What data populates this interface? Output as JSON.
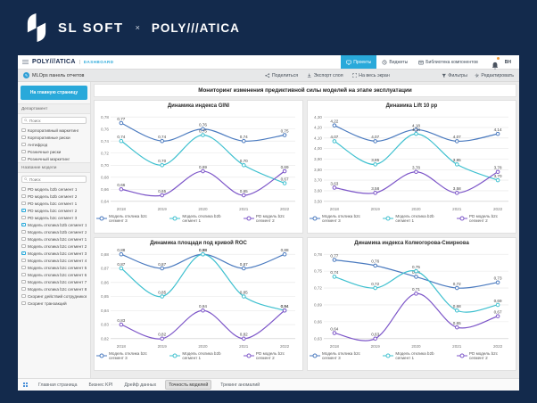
{
  "banner": {
    "brand_left": "SL SOFT",
    "separator": "×",
    "brand_right": "POLY///ATICA"
  },
  "app_header": {
    "logo": "POLY///ATICA",
    "badge": "DASHBOARD",
    "tabs": [
      {
        "label": "Проекты",
        "icon": "monitor-icon",
        "active": true
      },
      {
        "label": "Виджеты",
        "icon": "widgets-icon",
        "active": false
      },
      {
        "label": "Библиотека компонентов",
        "icon": "components-icon",
        "active": false
      }
    ],
    "user_initials": "ВН"
  },
  "toolbar": {
    "report_title": "MLOps панель отчетов",
    "actions": [
      {
        "label": "Поделиться",
        "icon": "share-icon"
      },
      {
        "label": "Экспорт слоя",
        "icon": "export-icon"
      },
      {
        "label": "На весь экран",
        "icon": "fullscreen-icon"
      }
    ],
    "right_actions": [
      {
        "label": "Фильтры",
        "icon": "filter-icon"
      },
      {
        "label": "Редактировать",
        "icon": "gear-icon"
      }
    ]
  },
  "sidebar": {
    "home_button": "На главную страницу",
    "sections": [
      {
        "title": "Департамент",
        "search_placeholder": "Поиск",
        "items": [
          {
            "label": "Корпоративный маркетинг",
            "checked": false
          },
          {
            "label": "Корпоративные риски",
            "checked": false
          },
          {
            "label": "Антифрод",
            "checked": false
          },
          {
            "label": "Розничные риски",
            "checked": false
          },
          {
            "label": "Розничный маркетинг",
            "checked": false
          }
        ]
      },
      {
        "title": "Название модели",
        "search_placeholder": "Поиск",
        "items": [
          {
            "label": "PD модель b2b сегмент 1",
            "checked": false
          },
          {
            "label": "PD модель b2b сегмент 2",
            "checked": false
          },
          {
            "label": "PD модель b2c сегмент 1",
            "checked": false
          },
          {
            "label": "PD модель b2c сегмент 2",
            "checked": true
          },
          {
            "label": "PD модель b2c сегмент 3",
            "checked": false
          },
          {
            "label": "Модель отклика b2b сегмент 1",
            "checked": true
          },
          {
            "label": "Модель отклика b2b сегмент 2",
            "checked": false
          },
          {
            "label": "Модель отклика b2c сегмент 1",
            "checked": false
          },
          {
            "label": "Модель отклика b2c сегмент 2",
            "checked": false
          },
          {
            "label": "Модель отклика b2c сегмент 3",
            "checked": true
          },
          {
            "label": "Модель отклика b2c сегмент 4",
            "checked": false
          },
          {
            "label": "Модель отклика b2c сегмент 5",
            "checked": false
          },
          {
            "label": "Модель отклика b2c сегмент 6",
            "checked": false
          },
          {
            "label": "Модель отклика b2c сегмент 7",
            "checked": false
          },
          {
            "label": "Модель отклика b2c сегмент 8",
            "checked": false
          },
          {
            "label": "Скоринг действий сотрудников",
            "checked": false
          },
          {
            "label": "Скоринг транзакций",
            "checked": false
          }
        ]
      }
    ]
  },
  "main": {
    "title": "Мониторинг изменения предиктивной силы моделей на этапе эксплуатации"
  },
  "chart_data": [
    {
      "type": "line",
      "title": "Динамика индекса GINI",
      "x": [
        "2018",
        "2019",
        "2020",
        "2021",
        "2022"
      ],
      "ylim": [
        0.64,
        0.78
      ],
      "ystep": 0.02,
      "decimals": 2,
      "grid": true,
      "legend_position": "bottom",
      "series": [
        {
          "name": "Модель отклика b2c сегмент 3",
          "color": "#4a7abf",
          "values": [
            0.77,
            0.74,
            0.76,
            0.74,
            0.75
          ]
        },
        {
          "name": "Модель отклика b2b сегмент 1",
          "color": "#3ec0cf",
          "values": [
            0.74,
            0.7,
            0.75,
            0.7,
            0.67
          ]
        },
        {
          "name": "PD модель b2c сегмент 2",
          "color": "#7c55c8",
          "values": [
            0.66,
            0.65,
            0.69,
            0.65,
            0.69
          ]
        }
      ]
    },
    {
      "type": "line",
      "title": "Динамика Lift 10 pp",
      "x": [
        "2018",
        "2019",
        "2020",
        "2021",
        "2022"
      ],
      "ylim": [
        3.5,
        4.3
      ],
      "ystep": 0.1,
      "decimals": 2,
      "grid": true,
      "legend_position": "bottom",
      "series": [
        {
          "name": "Модель отклика b2c сегмент 3",
          "color": "#4a7abf",
          "values": [
            4.22,
            4.07,
            4.18,
            4.07,
            4.14
          ]
        },
        {
          "name": "Модель отклика b2b сегмент 1",
          "color": "#3ec0cf",
          "values": [
            4.07,
            3.85,
            4.14,
            3.85,
            3.7
          ]
        },
        {
          "name": "PD модель b2c сегмент 2",
          "color": "#7c55c8",
          "values": [
            3.63,
            3.58,
            3.78,
            3.58,
            3.78
          ]
        }
      ]
    },
    {
      "type": "line",
      "title": "Динамика площади под кривой ROC",
      "x": [
        "2018",
        "2019",
        "2020",
        "2021",
        "2022"
      ],
      "ylim": [
        0.82,
        0.88
      ],
      "ystep": 0.01,
      "decimals": 2,
      "grid": true,
      "legend_position": "bottom",
      "series": [
        {
          "name": "Модель отклика b2c сегмент 3",
          "color": "#4a7abf",
          "values": [
            0.88,
            0.87,
            0.88,
            0.87,
            0.88
          ]
        },
        {
          "name": "Модель отклика b2b сегмент 1",
          "color": "#3ec0cf",
          "values": [
            0.87,
            0.85,
            0.88,
            0.85,
            0.84
          ]
        },
        {
          "name": "PD модель b2c сегмент 2",
          "color": "#7c55c8",
          "values": [
            0.83,
            0.82,
            0.84,
            0.82,
            0.84
          ]
        }
      ]
    },
    {
      "type": "line",
      "title": "Динамика индекса Колмогорова-Смирнова",
      "x": [
        "2018",
        "2019",
        "2020",
        "2021",
        "2022"
      ],
      "ylim": [
        0.63,
        0.78
      ],
      "ystep": 0.03,
      "decimals": 2,
      "grid": true,
      "legend_position": "bottom",
      "series": [
        {
          "name": "Модель отклика b2c сегмент 3",
          "color": "#4a7abf",
          "values": [
            0.77,
            0.76,
            0.74,
            0.72,
            0.73
          ]
        },
        {
          "name": "Модель отклика b2b сегмент 1",
          "color": "#3ec0cf",
          "values": [
            0.74,
            0.72,
            0.75,
            0.68,
            0.69
          ]
        },
        {
          "name": "PD модель b2c сегмент 2",
          "color": "#7c55c8",
          "values": [
            0.64,
            0.63,
            0.71,
            0.65,
            0.67
          ]
        }
      ]
    }
  ],
  "bottom_tabs": [
    {
      "label": "Главная страница",
      "active": false
    },
    {
      "label": "Бизнес KPI",
      "active": false
    },
    {
      "label": "Дрейф данных",
      "active": false
    },
    {
      "label": "Точность моделей",
      "active": true
    },
    {
      "label": "Трекинг аномалий",
      "active": false
    }
  ]
}
